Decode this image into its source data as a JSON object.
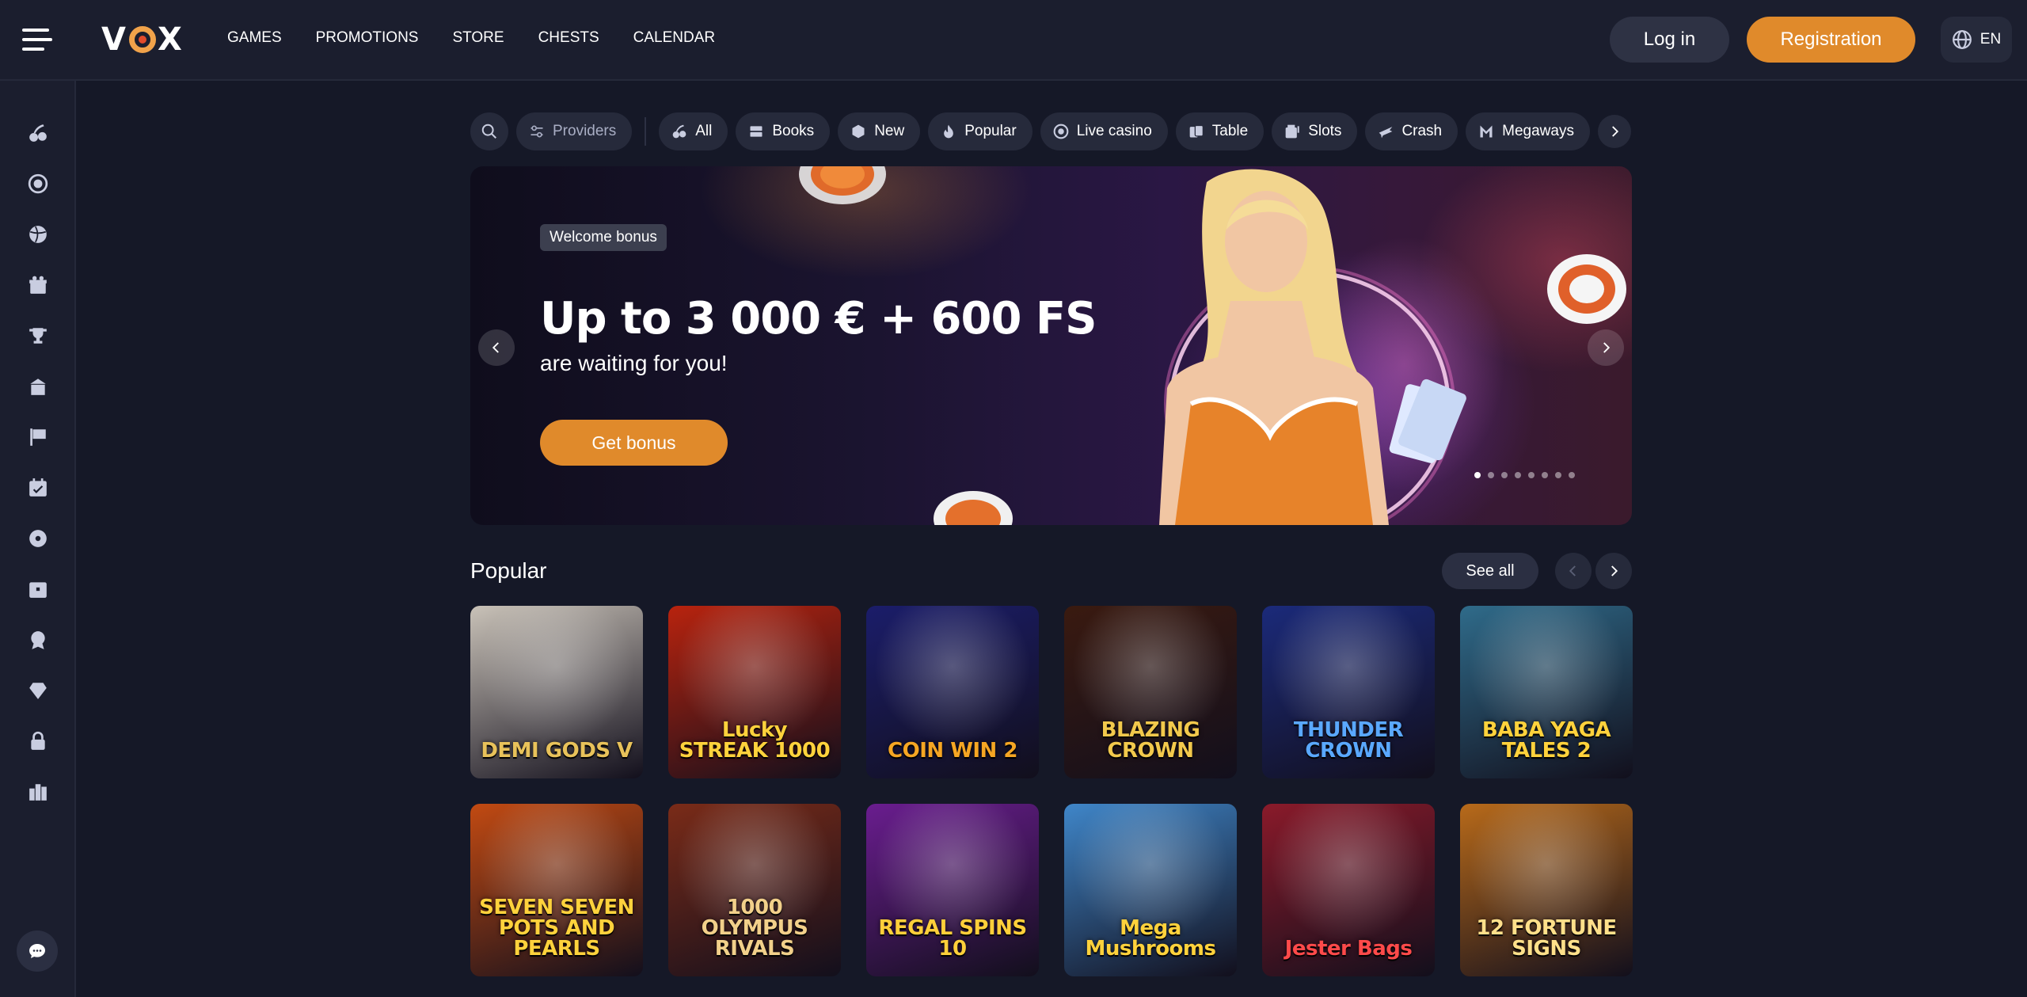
{
  "header": {
    "logo_text": "VOX",
    "nav": [
      "GAMES",
      "PROMOTIONS",
      "STORE",
      "CHESTS",
      "CALENDAR"
    ],
    "login_label": "Log in",
    "register_label": "Registration",
    "language": "EN"
  },
  "sidebar": {
    "icons": [
      "cherries-icon",
      "roulette-icon",
      "basketball-icon",
      "gift-icon",
      "trophy-icon",
      "shop-icon",
      "race-flag-icon",
      "calendar-icon",
      "wheel-icon",
      "chest-icon",
      "medal-icon",
      "diamond-icon",
      "lock-icon",
      "ladder-icon"
    ],
    "chat_icon": "chat-icon"
  },
  "filters": {
    "search_icon": "search-icon",
    "providers_label": "Providers",
    "chips": [
      {
        "label": "All",
        "icon": "cherries-icon"
      },
      {
        "label": "Books",
        "icon": "books-icon"
      },
      {
        "label": "New",
        "icon": "dice-icon"
      },
      {
        "label": "Popular",
        "icon": "fire-icon"
      },
      {
        "label": "Live casino",
        "icon": "chip-icon"
      },
      {
        "label": "Table",
        "icon": "cards-icon"
      },
      {
        "label": "Slots",
        "icon": "slot-icon"
      },
      {
        "label": "Crash",
        "icon": "plane-icon"
      },
      {
        "label": "Megaways",
        "icon": "megaways-icon"
      }
    ]
  },
  "banner": {
    "badge": "Welcome bonus",
    "title": "Up to 3 000 € + 600 FS",
    "subtitle": "are waiting for you!",
    "cta": "Get bonus",
    "slides_total": 8,
    "active_slide": 1
  },
  "popular": {
    "title": "Popular",
    "see_all": "See all",
    "games": [
      {
        "name": "DEMI GODS V",
        "bg": "#c9c2b8",
        "color": "#e8c25a"
      },
      {
        "name": "Lucky STREAK 1000",
        "bg": "#b8230e",
        "color": "#ffd23c"
      },
      {
        "name": "COIN WIN 2",
        "bg": "#1b1d6a",
        "color": "#f5a623"
      },
      {
        "name": "BLAZING CROWN",
        "bg": "#3a1a10",
        "color": "#f2c94c"
      },
      {
        "name": "THUNDER CROWN",
        "bg": "#1b2a7a",
        "color": "#5aa8ff"
      },
      {
        "name": "BABA YAGA TALES 2",
        "bg": "#2f6b8a",
        "color": "#ffd23c"
      },
      {
        "name": "SEVEN SEVEN POTS AND PEARLS",
        "bg": "#c24a12",
        "color": "#ffd23c"
      },
      {
        "name": "1000 OLYMPUS RIVALS",
        "bg": "#7a2b18",
        "color": "#f2d08a"
      },
      {
        "name": "REGAL SPINS 10",
        "bg": "#6a1d8f",
        "color": "#ffcf3a"
      },
      {
        "name": "Mega Mushrooms",
        "bg": "#3f86c9",
        "color": "#ffd23c"
      },
      {
        "name": "Jester Bags",
        "bg": "#8a1a2a",
        "color": "#ff4a4a"
      },
      {
        "name": "12 FORTUNE SIGNS",
        "bg": "#b86a1a",
        "color": "#ffe08a"
      }
    ]
  }
}
